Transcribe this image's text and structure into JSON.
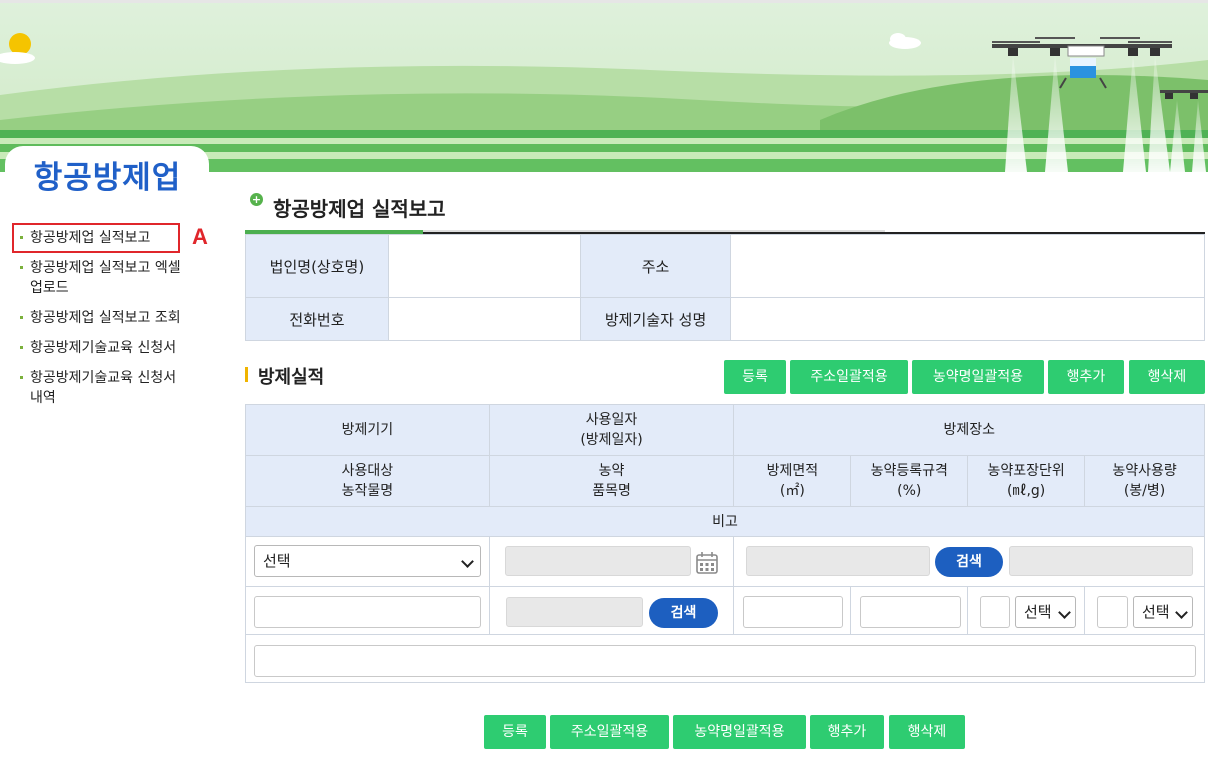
{
  "sidebar": {
    "title": "항공방제업",
    "items": [
      {
        "label": "항공방제업 실적보고"
      },
      {
        "label": "항공방제업 실적보고 엑셀"
      },
      {
        "label": "업로드"
      },
      {
        "label": "항공방제업 실적보고 조회"
      },
      {
        "label": "항공방제기술교육 신청서"
      },
      {
        "label": "항공방제기술교육 신청서"
      },
      {
        "label": "내역"
      }
    ],
    "highlight_marker": "A"
  },
  "page": {
    "title": "항공방제업 실적보고"
  },
  "info": {
    "corp_name_label": "법인명(상호명)",
    "corp_name_value": "",
    "address_label": "주소",
    "address_value": "",
    "phone_label": "전화번호",
    "phone_value": "",
    "technician_label": "방제기술자 성명",
    "technician_value": ""
  },
  "section": {
    "title": "방제실적",
    "buttons": {
      "register": "등록",
      "apply_address": "주소일괄적용",
      "apply_pesticide": "농약명일괄적용",
      "add_row": "행추가",
      "delete_row": "행삭제"
    }
  },
  "table": {
    "headers": {
      "device": "방제기기",
      "date_line1": "사용일자",
      "date_line2": "(방제일자)",
      "place": "방제장소",
      "crop_line1": "사용대상",
      "crop_line2": "농작물명",
      "pesticide_line1": "농약",
      "pesticide_line2": "품목명",
      "area_line1": "방제면적",
      "area_line2": "(㎡)",
      "spec_line1": "농약등록규격",
      "spec_line2": "(%)",
      "unit_line1": "농약포장단위",
      "unit_line2": "(㎖,g)",
      "usage_line1": "농약사용량",
      "usage_line2": "(봉/병)",
      "remark": "비고"
    },
    "row": {
      "device_select": "선택",
      "search_label": "검색",
      "unit_select": "선택",
      "usage_select": "선택"
    }
  },
  "bottom_buttons": {
    "register": "등록",
    "apply_address": "주소일괄적용",
    "apply_pesticide": "농약명일괄적용",
    "add_row": "행추가",
    "delete_row": "행삭제"
  },
  "colors": {
    "brand_blue": "#2060c8",
    "green_button": "#2ecc71",
    "blue_button": "#1d5fc0",
    "header_bg": "#e3ebf9",
    "highlight_red": "#e0262b"
  }
}
